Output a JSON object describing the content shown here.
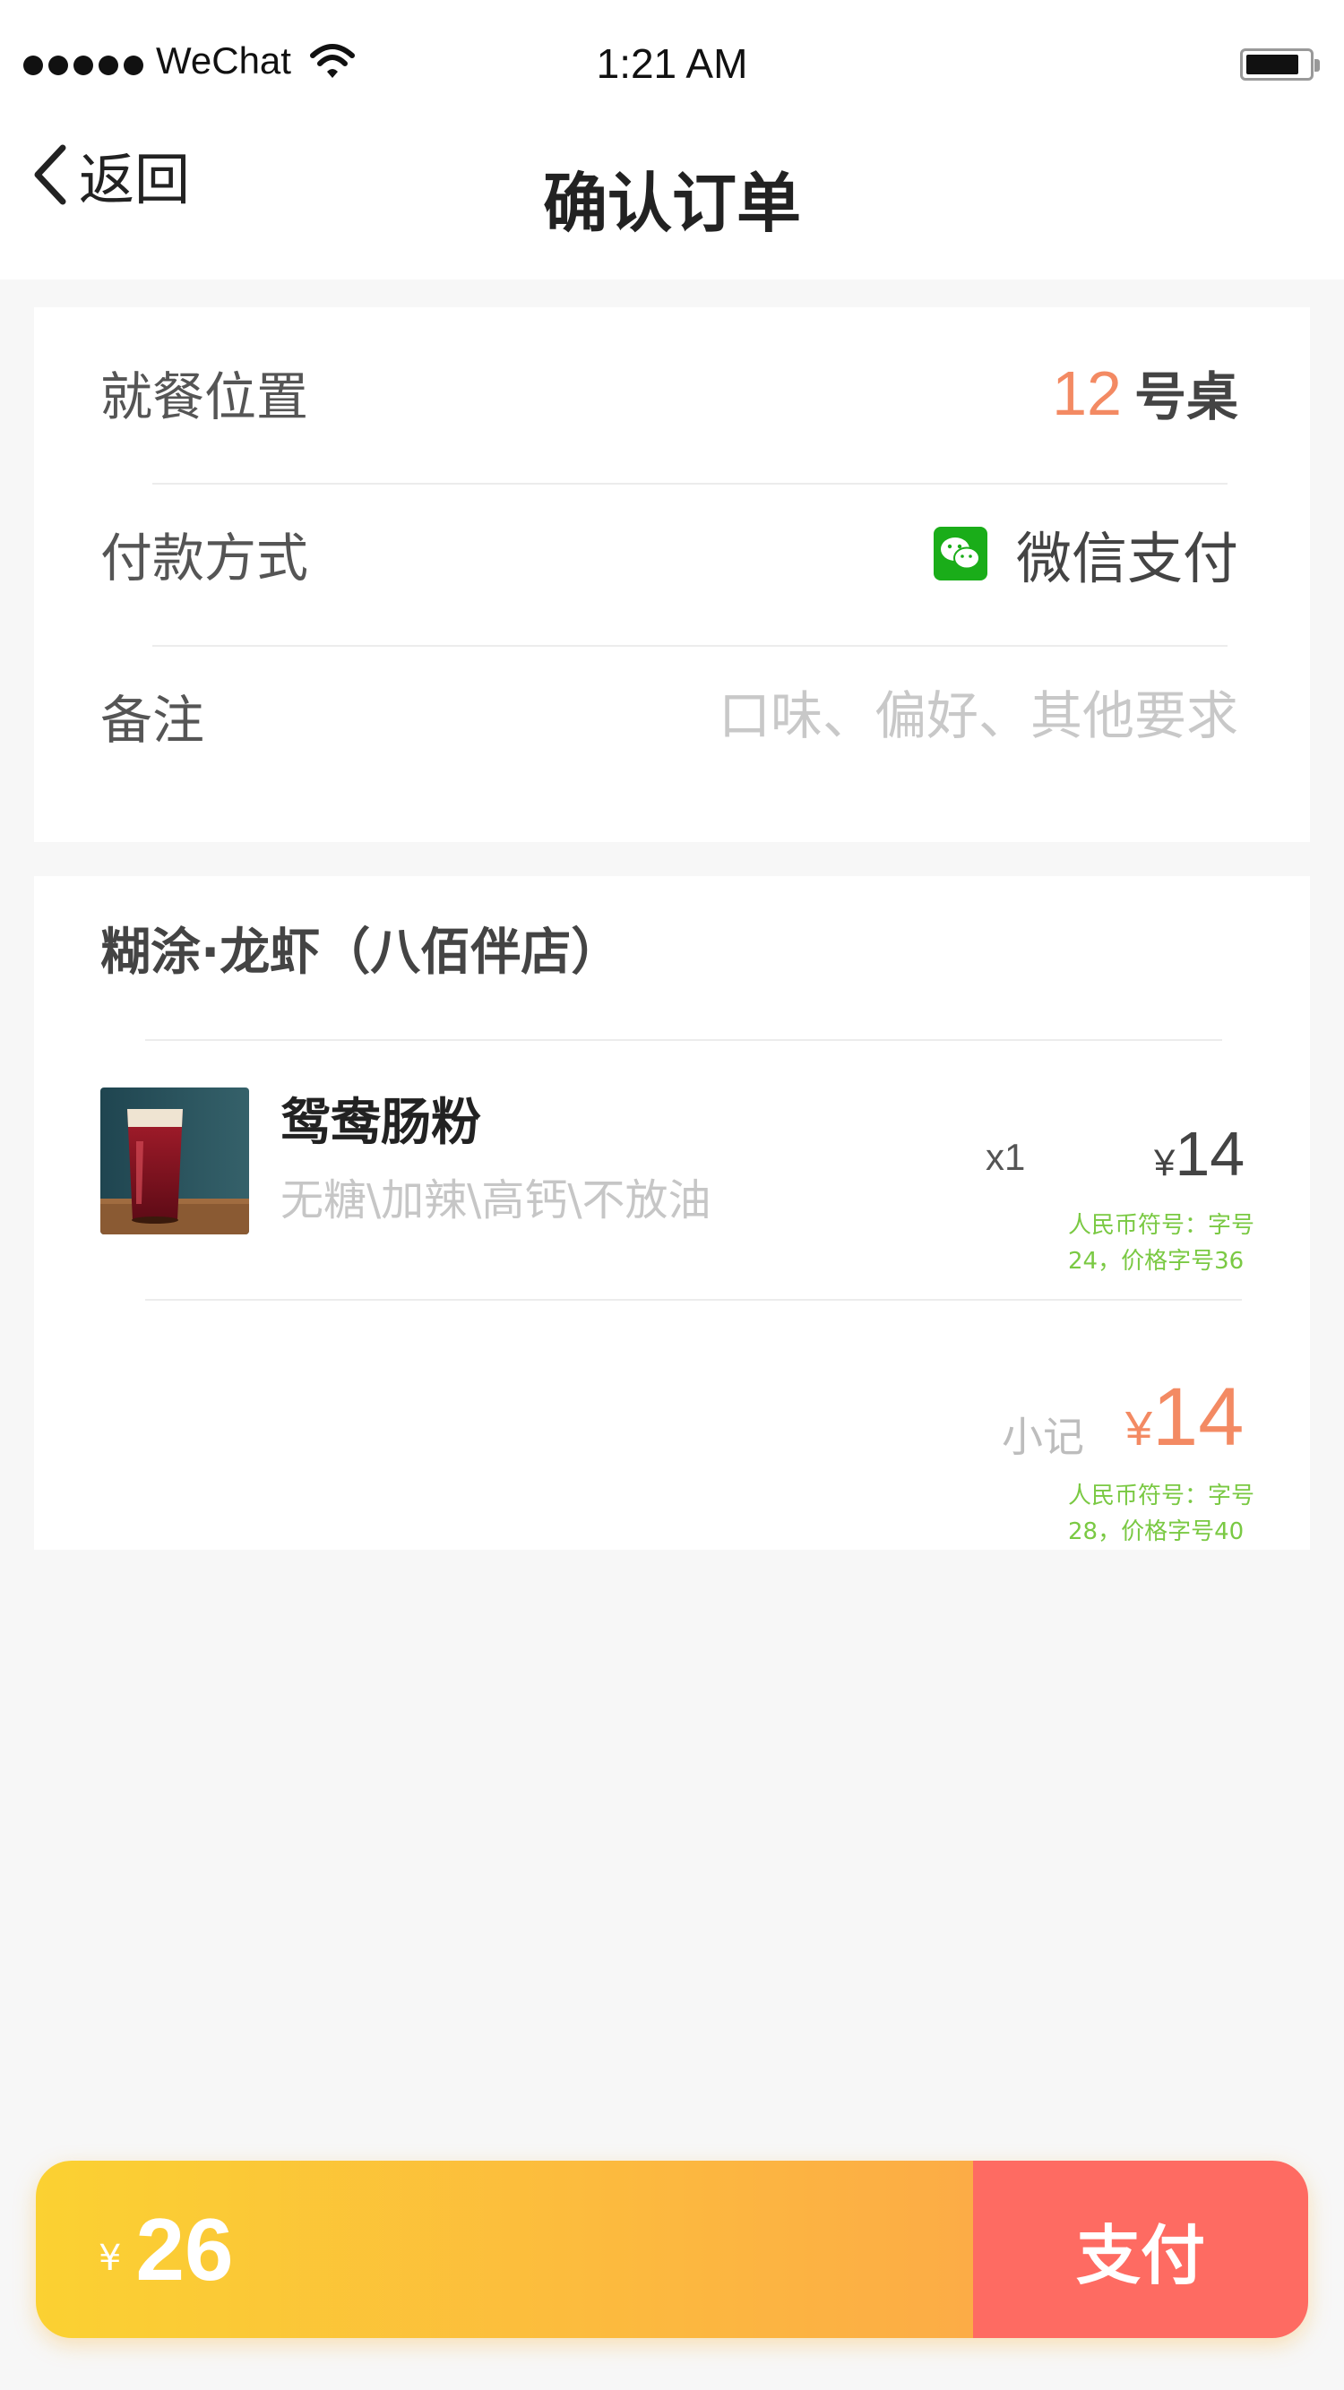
{
  "status_bar": {
    "carrier": "WeChat",
    "time": "1:21 AM"
  },
  "nav": {
    "back_label": "返回",
    "title": "确认订单"
  },
  "order_info": {
    "location_label": "就餐位置",
    "table_number": "12",
    "table_unit": "号桌",
    "payment_label": "付款方式",
    "payment_method": "微信支付",
    "payment_icon": "wechat-icon",
    "remark_label": "备注",
    "remark_placeholder": "口味、偏好、其他要求"
  },
  "shop": {
    "name": "糊涂·龙虾（八佰伴店）",
    "items": [
      {
        "name": "鸳鸯肠粉",
        "options": "无糖\\加辣\\高钙\\不放油",
        "quantity": "x1",
        "currency": "¥",
        "price": "14"
      }
    ],
    "price_annotation": "人民币符号：字号\n24，价格字号36",
    "subtotal_label": "小记",
    "subtotal_currency": "¥",
    "subtotal": "14",
    "subtotal_annotation": "人民币符号：字号\n28，价格字号40"
  },
  "pay_bar": {
    "currency": "¥",
    "total": "26",
    "pay_label": "支付"
  },
  "colors": {
    "accent_orange": "#f38a63",
    "wechat_green": "#1aad19",
    "gradient_start": "#fbd132",
    "gradient_end": "#fcac46",
    "pay_button": "#fe6b62",
    "annotation_green": "#7ac943"
  }
}
